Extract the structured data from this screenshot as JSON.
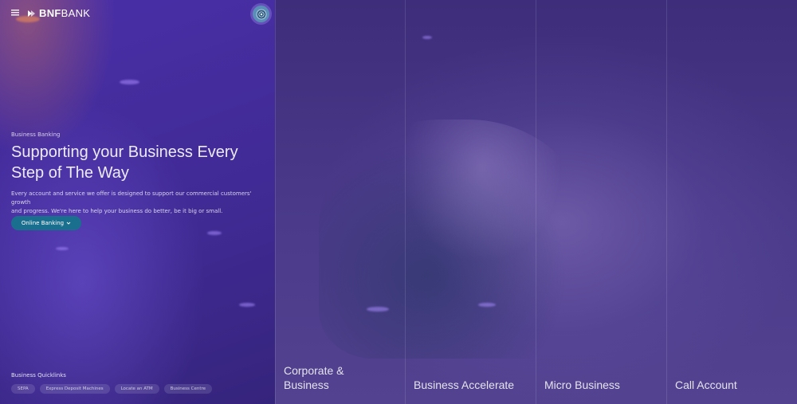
{
  "brand": {
    "logo_bold": "BNF",
    "logo_rest": "BANK"
  },
  "header": {
    "menu_icon": "hamburger-menu-icon",
    "language_icon": "flag-seal-icon"
  },
  "hero": {
    "eyebrow": "Business Banking",
    "title_lines": [
      "Supporting your Business Every",
      "Step of The Way"
    ],
    "description_lines": [
      "Every account and service we offer is designed to support our commercial customers' growth",
      "and progress. We're here to help your business do better, be it big or small."
    ],
    "cta_label": "Online Banking"
  },
  "quicklinks": {
    "title": "Business Quicklinks",
    "items": [
      "SEPA",
      "Express Deposit Machines",
      "Locate an ATM",
      "Business Centre"
    ]
  },
  "panels": [
    {
      "label_lines": [
        "Corporate &",
        "Business"
      ]
    },
    {
      "label_lines": [
        "Business Accelerate"
      ]
    },
    {
      "label_lines": [
        "Micro Business"
      ]
    },
    {
      "label_lines": [
        "Call Account"
      ]
    }
  ],
  "colors": {
    "overlay": "#4a2fa8",
    "cta": "#1a6f8f"
  }
}
